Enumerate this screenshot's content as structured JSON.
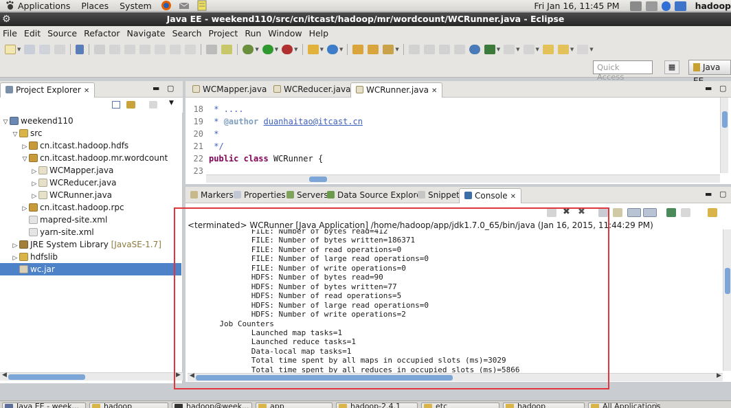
{
  "top_panel": {
    "menus": [
      "Applications",
      "Places",
      "System"
    ],
    "clock": "Fri Jan 16, 11:45 PM",
    "user": "hadoop"
  },
  "window": {
    "title": "Java EE - weekend110/src/cn/itcast/hadoop/mr/wordcount/WCRunner.java - Eclipse"
  },
  "menubar": [
    "File",
    "Edit",
    "Source",
    "Refactor",
    "Navigate",
    "Search",
    "Project",
    "Run",
    "Window",
    "Help"
  ],
  "toolbar": {
    "quick_access_placeholder": "Quick Access",
    "perspective_label": "Java EE"
  },
  "explorer": {
    "tab_label": "Project Explorer",
    "tree": [
      {
        "label": "weekend110",
        "depth": 0,
        "twisty": "open",
        "icon": "project-icon"
      },
      {
        "label": "src",
        "depth": 1,
        "twisty": "open",
        "icon": "source-folder-icon"
      },
      {
        "label": "cn.itcast.hadoop.hdfs",
        "depth": 2,
        "twisty": "closed",
        "icon": "package-icon"
      },
      {
        "label": "cn.itcast.hadoop.mr.wordcount",
        "depth": 2,
        "twisty": "open",
        "icon": "package-icon"
      },
      {
        "label": "WCMapper.java",
        "depth": 3,
        "twisty": "closed",
        "icon": "java-file-icon"
      },
      {
        "label": "WCReducer.java",
        "depth": 3,
        "twisty": "closed",
        "icon": "java-file-icon"
      },
      {
        "label": "WCRunner.java",
        "depth": 3,
        "twisty": "closed",
        "icon": "java-file-icon"
      },
      {
        "label": "cn.itcast.hadoop.rpc",
        "depth": 2,
        "twisty": "closed",
        "icon": "package-icon"
      },
      {
        "label": "mapred-site.xml",
        "depth": 2,
        "twisty": "none",
        "icon": "xml-file-icon"
      },
      {
        "label": "yarn-site.xml",
        "depth": 2,
        "twisty": "none",
        "icon": "xml-file-icon"
      },
      {
        "label": "JRE System Library",
        "suffix": "[JavaSE-1.7]",
        "depth": 1,
        "twisty": "closed",
        "icon": "library-icon"
      },
      {
        "label": "hdfslib",
        "depth": 1,
        "twisty": "closed",
        "icon": "folder-icon"
      },
      {
        "label": "wc.jar",
        "depth": 1,
        "twisty": "none",
        "icon": "jar-file-icon",
        "selected": true
      }
    ]
  },
  "editor": {
    "tabs": [
      {
        "label": "WCMapper.java",
        "active": false
      },
      {
        "label": "WCReducer.java",
        "active": false
      },
      {
        "label": "WCRunner.java",
        "active": true
      }
    ],
    "lines": [
      {
        "num": "18",
        "text": " * ...."
      },
      {
        "num": "19",
        "text_pre": " * ",
        "tag": "@author",
        "link": "duanhaitao@itcast.cn"
      },
      {
        "num": "20",
        "text": " *"
      },
      {
        "num": "21",
        "text": " */"
      },
      {
        "num": "22",
        "kw1": "public",
        "kw2": "class",
        "text": " WCRunner {"
      },
      {
        "num": "23",
        "text": ""
      }
    ]
  },
  "bottom_tabs": [
    {
      "label": "Markers",
      "active": false
    },
    {
      "label": "Properties",
      "active": false
    },
    {
      "label": "Servers",
      "active": false
    },
    {
      "label": "Data Source Explorer",
      "active": false
    },
    {
      "label": "Snippets",
      "active": false
    },
    {
      "label": "Console",
      "active": true
    }
  ],
  "console": {
    "status": "<terminated> WCRunner [Java Application] /home/hadoop/app/jdk1.7.0_65/bin/java (Jan 16, 2015, 11:44:29 PM)",
    "lines": [
      "\t\tFILE: Number of bytes read=412",
      "\t\tFILE: Number of bytes written=186371",
      "\t\tFILE: Number of read operations=0",
      "\t\tFILE: Number of large read operations=0",
      "\t\tFILE: Number of write operations=0",
      "\t\tHDFS: Number of bytes read=90",
      "\t\tHDFS: Number of bytes written=77",
      "\t\tHDFS: Number of read operations=5",
      "\t\tHDFS: Number of large read operations=0",
      "\t\tHDFS: Number of write operations=2",
      "\tJob Counters ",
      "\t\tLaunched map tasks=1",
      "\t\tLaunched reduce tasks=1",
      "\t\tData-local map tasks=1",
      "\t\tTotal time spent by all maps in occupied slots (ms)=3029",
      "\t\tTotal time spent by all reduces in occupied slots (ms)=5866"
    ]
  },
  "taskbar": [
    "Java EE - week...",
    "hadoop",
    "hadoop@week...",
    "app",
    "hadoop-2.4.1",
    "etc",
    "hadoop",
    "All Applications"
  ],
  "colors": {
    "highlight": "#e0353b",
    "selection": "#4d82c9",
    "comment": "#3f5fbf",
    "keyword": "#7f0055"
  }
}
